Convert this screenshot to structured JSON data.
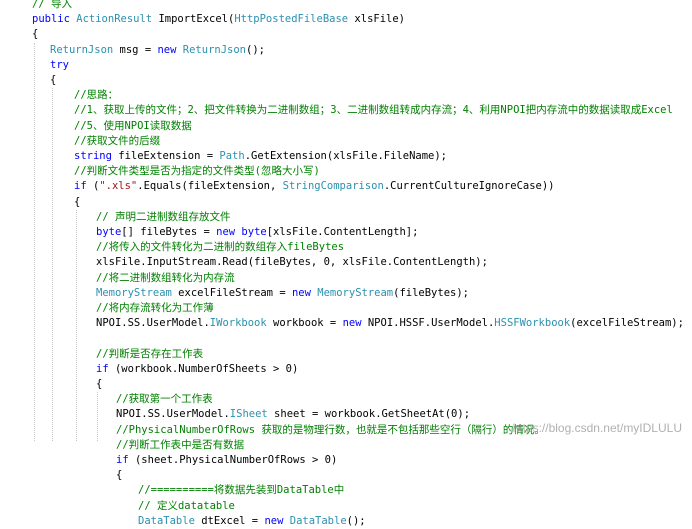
{
  "lines": [
    {
      "indent": 0,
      "parts": [
        [
          "cm",
          "// 导入"
        ]
      ]
    },
    {
      "indent": 0,
      "parts": [
        [
          "kw",
          "public"
        ],
        [
          "tx",
          " "
        ],
        [
          "ty",
          "ActionResult"
        ],
        [
          "tx",
          " ImportExcel("
        ],
        [
          "ty",
          "HttpPostedFileBase"
        ],
        [
          "tx",
          " xlsFile)"
        ]
      ]
    },
    {
      "indent": 0,
      "parts": [
        [
          "tx",
          "{"
        ]
      ]
    },
    {
      "indent": 1,
      "parts": [
        [
          "ty",
          "ReturnJson"
        ],
        [
          "tx",
          " msg = "
        ],
        [
          "kw",
          "new"
        ],
        [
          "tx",
          " "
        ],
        [
          "ty",
          "ReturnJson"
        ],
        [
          "tx",
          "();"
        ]
      ]
    },
    {
      "indent": 1,
      "parts": [
        [
          "kw",
          "try"
        ]
      ]
    },
    {
      "indent": 1,
      "parts": [
        [
          "tx",
          "{"
        ]
      ]
    },
    {
      "indent": 2,
      "parts": [
        [
          "cm",
          "//思路："
        ]
      ]
    },
    {
      "indent": 2,
      "parts": [
        [
          "cm",
          "//1、获取上传的文件；2、把文件转换为二进制数组；3、二进制数组转成内存流；4、利用NPOI把内存流中的数据读取成Excel"
        ]
      ]
    },
    {
      "indent": 2,
      "parts": [
        [
          "cm",
          "//5、使用NPOI读取数据"
        ]
      ]
    },
    {
      "indent": 2,
      "parts": [
        [
          "cm",
          "//获取文件的后缀"
        ]
      ]
    },
    {
      "indent": 2,
      "parts": [
        [
          "kw",
          "string"
        ],
        [
          "tx",
          " fileExtension = "
        ],
        [
          "ty",
          "Path"
        ],
        [
          "tx",
          ".GetExtension(xlsFile.FileName);"
        ]
      ]
    },
    {
      "indent": 2,
      "parts": [
        [
          "cm",
          "//判断文件类型是否为指定的文件类型(忽略大小写)"
        ]
      ]
    },
    {
      "indent": 2,
      "parts": [
        [
          "kw",
          "if"
        ],
        [
          "tx",
          " ("
        ],
        [
          "st",
          "\".xls\""
        ],
        [
          "tx",
          ".Equals(fileExtension, "
        ],
        [
          "ty",
          "StringComparison"
        ],
        [
          "tx",
          ".CurrentCultureIgnoreCase))"
        ]
      ]
    },
    {
      "indent": 2,
      "parts": [
        [
          "tx",
          "{"
        ]
      ]
    },
    {
      "indent": 3,
      "parts": [
        [
          "cm",
          "// 声明二进制数组存放文件"
        ]
      ]
    },
    {
      "indent": 3,
      "parts": [
        [
          "kw",
          "byte"
        ],
        [
          "tx",
          "[] fileBytes = "
        ],
        [
          "kw",
          "new"
        ],
        [
          "tx",
          " "
        ],
        [
          "kw",
          "byte"
        ],
        [
          "tx",
          "[xlsFile.ContentLength];"
        ]
      ]
    },
    {
      "indent": 3,
      "parts": [
        [
          "cm",
          "//将传入的文件转化为二进制的数组存入fileBytes"
        ]
      ]
    },
    {
      "indent": 3,
      "parts": [
        [
          "tx",
          "xlsFile.InputStream.Read(fileBytes, 0, xlsFile.ContentLength);"
        ]
      ]
    },
    {
      "indent": 3,
      "parts": [
        [
          "cm",
          "//将二进制数组转化为内存流"
        ]
      ]
    },
    {
      "indent": 3,
      "parts": [
        [
          "ty",
          "MemoryStream"
        ],
        [
          "tx",
          " excelFileStream = "
        ],
        [
          "kw",
          "new"
        ],
        [
          "tx",
          " "
        ],
        [
          "ty",
          "MemoryStream"
        ],
        [
          "tx",
          "(fileBytes);"
        ]
      ]
    },
    {
      "indent": 3,
      "parts": [
        [
          "cm",
          "//将内存流转化为工作薄"
        ]
      ]
    },
    {
      "indent": 3,
      "parts": [
        [
          "tx",
          "NPOI.SS.UserModel."
        ],
        [
          "ty",
          "IWorkbook"
        ],
        [
          "tx",
          " workbook = "
        ],
        [
          "kw",
          "new"
        ],
        [
          "tx",
          " NPOI.HSSF.UserModel."
        ],
        [
          "ty",
          "HSSFWorkbook"
        ],
        [
          "tx",
          "(excelFileStream);"
        ]
      ]
    },
    {
      "indent": 3,
      "parts": [
        [
          "tx",
          ""
        ]
      ]
    },
    {
      "indent": 3,
      "parts": [
        [
          "cm",
          "//判断是否存在工作表"
        ]
      ]
    },
    {
      "indent": 3,
      "parts": [
        [
          "kw",
          "if"
        ],
        [
          "tx",
          " (workbook.NumberOfSheets > 0)"
        ]
      ]
    },
    {
      "indent": 3,
      "parts": [
        [
          "tx",
          "{"
        ]
      ]
    },
    {
      "indent": 4,
      "parts": [
        [
          "cm",
          "//获取第一个工作表"
        ]
      ]
    },
    {
      "indent": 4,
      "parts": [
        [
          "tx",
          "NPOI.SS.UserModel."
        ],
        [
          "ty",
          "ISheet"
        ],
        [
          "tx",
          " sheet = workbook.GetSheetAt(0);"
        ]
      ]
    },
    {
      "indent": 4,
      "parts": [
        [
          "cm",
          "//PhysicalNumberOfRows 获取的是物理行数，也就是不包括那些空行（隔行）的情况。"
        ]
      ]
    },
    {
      "indent": 4,
      "parts": [
        [
          "cm",
          "//判断工作表中是否有数据"
        ]
      ]
    },
    {
      "indent": 4,
      "parts": [
        [
          "kw",
          "if"
        ],
        [
          "tx",
          " (sheet.PhysicalNumberOfRows > 0)"
        ]
      ]
    },
    {
      "indent": 4,
      "parts": [
        [
          "tx",
          "{"
        ]
      ]
    },
    {
      "indent": 5,
      "parts": [
        [
          "cm",
          "//==========将数据先装到DataTable中"
        ]
      ]
    },
    {
      "indent": 5,
      "parts": [
        [
          "cm",
          "// 定义datatable"
        ]
      ]
    },
    {
      "indent": 5,
      "parts": [
        [
          "ty",
          "DataTable"
        ],
        [
          "tx",
          " dtExcel = "
        ],
        [
          "kw",
          "new"
        ],
        [
          "tx",
          " "
        ],
        [
          "ty",
          "DataTable"
        ],
        [
          "tx",
          "();"
        ]
      ]
    }
  ],
  "watermark": "https://blog.csdn.net/myIDLULU",
  "colors": {
    "keyword": "#0000ff",
    "type": "#2b91af",
    "comment": "#008000",
    "string": "#a31515"
  }
}
